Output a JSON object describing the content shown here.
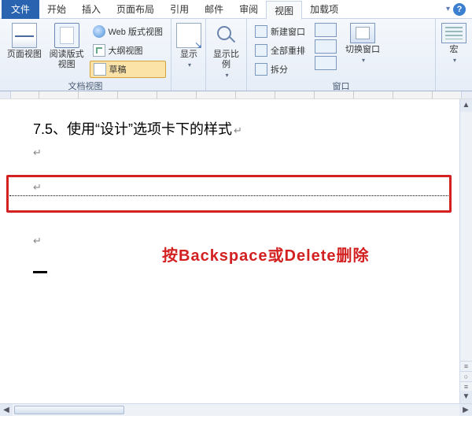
{
  "tabs": {
    "file": "文件",
    "items": [
      "开始",
      "插入",
      "页面布局",
      "引用",
      "邮件",
      "审阅",
      "视图",
      "加载项"
    ],
    "active_index": 6
  },
  "ribbon": {
    "group_views": {
      "label": "文档视图",
      "page_view": "页面视图",
      "read_view": "阅读版式视图",
      "web_view": "Web 版式视图",
      "outline_view": "大纲视图",
      "draft": "草稿"
    },
    "group_show": {
      "label": "显示",
      "btn": "显示"
    },
    "group_zoom": {
      "label": "",
      "btn": "显示比例"
    },
    "group_window": {
      "label": "窗口",
      "new_window": "新建窗口",
      "arrange_all": "全部重排",
      "split": "拆分",
      "switch": "切换窗口"
    },
    "group_macro": {
      "label": "宏",
      "btn": "宏"
    }
  },
  "document": {
    "heading": "7.5、使用“设计”选项卡下的样式",
    "para_return": "↵",
    "annotation": "按Backspace或Delete删除"
  },
  "icons": {
    "dropdown": "▾",
    "help": "?",
    "up": "▲",
    "down": "▼",
    "left": "◀",
    "right": "▶",
    "circle": "○",
    "dbl": "≡"
  }
}
